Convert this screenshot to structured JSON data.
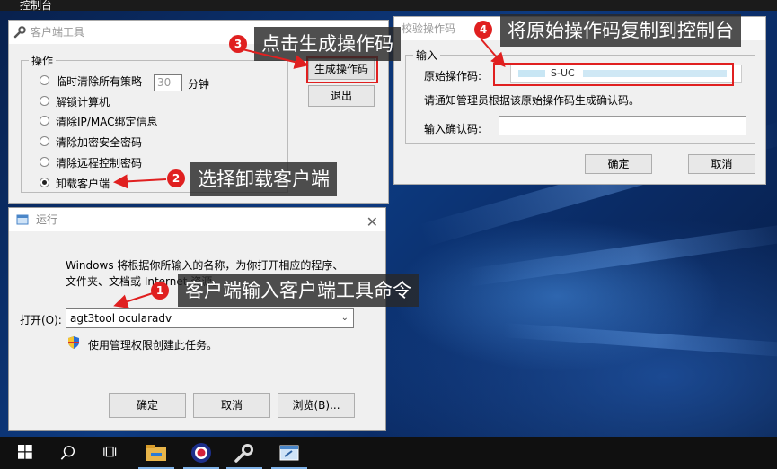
{
  "top_window_title": "控制台",
  "client_tool": {
    "title": "客户端工具",
    "group_label": "操作",
    "options": [
      {
        "label": "临时清除所有策略",
        "checked": false
      },
      {
        "label": "解锁计算机",
        "checked": false
      },
      {
        "label": "清除IP/MAC绑定信息",
        "checked": false
      },
      {
        "label": "清除加密安全密码",
        "checked": false
      },
      {
        "label": "清除远程控制密码",
        "checked": false
      },
      {
        "label": "卸载客户端",
        "checked": true
      }
    ],
    "minutes_value": "30",
    "minutes_unit": "分钟",
    "generate_button": "生成操作码",
    "exit_button": "退出"
  },
  "verify_dialog": {
    "title": "校验操作码",
    "group_label": "输入",
    "original_code_label": "原始操作码:",
    "original_code_value": "S-UC",
    "hint": "请通知管理员根据该原始操作码生成确认码。",
    "confirm_code_label": "输入确认码:",
    "ok_button": "确定",
    "cancel_button": "取消"
  },
  "run_dialog": {
    "title": "运行",
    "description": "Windows 将根据你所输入的名称，为你打开相应的程序、文件夹、文档或 Internet 资源。",
    "open_label": "打开(O):",
    "command_value": "agt3tool ocularadv",
    "admin_note": "使用管理权限创建此任务。",
    "ok_button": "确定",
    "cancel_button": "取消",
    "browse_button": "浏览(B)..."
  },
  "callouts": [
    {
      "num": "1",
      "text": "客户端输入客户端工具命令"
    },
    {
      "num": "2",
      "text": "选择卸载客户端"
    },
    {
      "num": "3",
      "text": "点击生成操作码"
    },
    {
      "num": "4",
      "text": "将原始操作码复制到控制台"
    }
  ],
  "taskbar_icons": [
    "windows-start-icon",
    "search-icon",
    "task-view-icon",
    "file-explorer-icon",
    "console-app-icon",
    "client-tool-icon",
    "run-dialog-icon"
  ],
  "colors": {
    "accent_red": "#e02020",
    "callout_bg": "#282828",
    "taskbar": "#101010"
  }
}
